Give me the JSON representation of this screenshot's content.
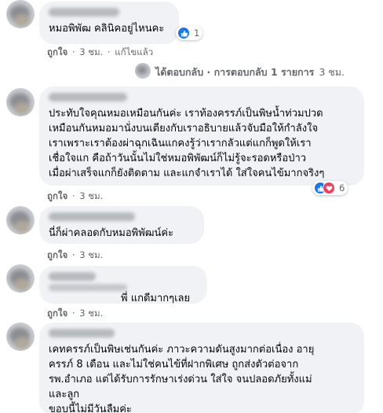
{
  "reaction_colors": {
    "like": "#1877f2",
    "love": "#f33e58"
  },
  "comments": [
    {
      "text": "หมอพิพัฒ คลินิคอยู่ไหนคะ",
      "reaction_count": "1",
      "actions": {
        "like": "ถูกใจ",
        "time": "3 ชม.",
        "edited": "แก้ไขแล้ว"
      }
    },
    {
      "text": "ประทับใจคุณหมอเหมือนกันค่ะ เราท้องครรภ์เป็นพิษน้ำท่วมปวด\nเหมือนกันหมอมานั่งบนเตียงกับเราอธิบายแล้วจับมือให้กำลังใจ\nเราเพราะเราต้องผ่าฉุกเฉินแกคงรู้ว่าเรากลัวแต่แกก็พูดให้เรา\nเชื่อใจแก คือถ้าวันนั้นไม่ใช่หมอพิพัฒน์ก็ไม่รู้จะรอดหรือป่าว\nเมื่อผ่าเสร็จแกก็ยังติดตาม และแกจำเราได้ ใส่ใจคนไข้มากจริงๆ",
      "reaction_count": "6",
      "actions": {
        "like": "ถูกใจ",
        "time": "3 ชม."
      }
    },
    {
      "text": "นี่ก็ผ่าคลอดกับหมอพิพัฒน์ค่ะ",
      "actions": {
        "like": "ถูกใจ",
        "time": "3 ชม."
      }
    },
    {
      "text": "พี่ แกดีมากๆเลย",
      "actions": {
        "like": "ถูกใจ",
        "time": "3 ชม."
      }
    },
    {
      "text": "เคทครรภ์เป็นพิษเช่นกันค่ะ ภาวะความดันสูงมากต่อเนื่อง อายุ\nครรภ์ 8 เดือน และไม่ใช่คนไข้ที่ฝากพิเศษ ถูกส่งตัวต่อจาก\nรพ.อำเภอ แต่ได้รับการรักษาเร่งด่วน ใส่ใจ จนปลอดภัยทั้งแม่\nและลูก\nขอบนี้ไม่มีวันลืมค่ะ"
    }
  ],
  "reply_row": {
    "text": "ได้ตอบกลับ · การตอบกลับ 1 รายการ",
    "time": "3 ชม."
  }
}
